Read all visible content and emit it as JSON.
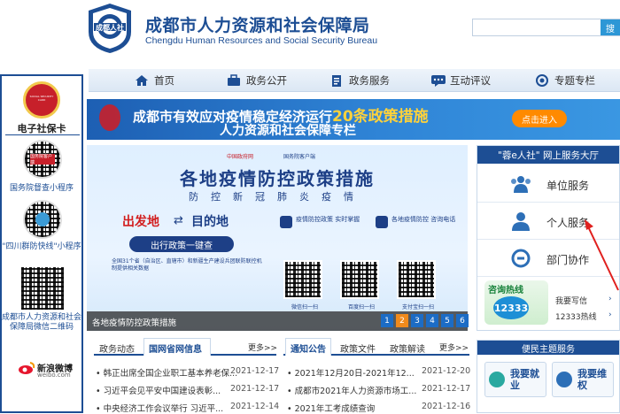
{
  "header": {
    "logo_text": "成都人社",
    "title_cn": "成都市人力资源和社会保障局",
    "title_en": "Chengdu Human Resources and Social Security Bureau",
    "search_button": "搜"
  },
  "nav": {
    "items": [
      {
        "label": "首页",
        "icon": "home-icon"
      },
      {
        "label": "政务公开",
        "icon": "briefcase-icon"
      },
      {
        "label": "政务服务",
        "icon": "clipboard-icon"
      },
      {
        "label": "互动评议",
        "icon": "chat-icon"
      },
      {
        "label": "专题专栏",
        "icon": "medal-icon"
      }
    ]
  },
  "left_sidebar": {
    "badge_text": "SOCIAL SECURITY CARD",
    "social_card_label": "电子社保卡",
    "qr1_label": "国务院客户端",
    "qr1_caption": "国务院督查小程序",
    "qr2_caption": "\"四川群防快线\"小程序",
    "qr3_caption": "成都市人力资源和社会保障局微信二维码",
    "weibo_label": "新浪微博",
    "weibo_sub": "weibo.com"
  },
  "banner": {
    "line1_prefix": "成都市有效应对疫情稳定经济运行",
    "line1_highlight": "20条政策措施",
    "line2": "人力资源和社会保障专栏",
    "button": "点击进入"
  },
  "slide": {
    "logo1": "中国政府网",
    "logo2": "国务院客户端",
    "title": "各地疫情防控政策措施",
    "subtitle": "防控新冠肺炎疫情",
    "from": "出发地",
    "to": "目的地",
    "query_btn": "出行政策一键查",
    "note": "全国31个省（自治区、直辖市）和新疆生产建设兵团联防联控机制提供相关数据",
    "feature1": "疫情防控政策 实时掌握",
    "feature2": "各地疫情防控 咨询电话",
    "qr_labels": [
      "微信扫一扫",
      "百度扫一扫",
      "支付宝扫一扫"
    ],
    "caption": "各地疫情防控政策措施",
    "pages": [
      "1",
      "2",
      "3",
      "4",
      "5",
      "6"
    ],
    "active_page": "2"
  },
  "service_hall": {
    "title": "\"蓉e人社\" 网上服务大厅",
    "items": [
      {
        "label": "单位服务",
        "icon": "group-icon"
      },
      {
        "label": "个人服务",
        "icon": "person-icon"
      },
      {
        "label": "部门协作",
        "icon": "link-icon"
      }
    ],
    "hotline_title": "咨询热线",
    "hotline_number": "12333",
    "links": [
      "我要写信",
      "12333热线"
    ]
  },
  "news1": {
    "tabs": [
      "政务动态",
      "国网省网信息"
    ],
    "more": "更多>>",
    "rows": [
      {
        "title": "韩正出席全国企业职工基本养老保...",
        "date": "2021-12-17"
      },
      {
        "title": "习近平会见平安中国建设表彰...",
        "date": "2021-12-17"
      },
      {
        "title": "中央经济工作会议举行 习近平...",
        "date": "2021-12-14"
      }
    ]
  },
  "news2": {
    "tabs": [
      "通知公告",
      "政策文件",
      "政策解读"
    ],
    "more": "更多>>",
    "rows": [
      {
        "title": "2021年12月20日-2021年12...",
        "date": "2021-12-20"
      },
      {
        "title": "成都市2021年人力资源市场工...",
        "date": "2021-12-17"
      },
      {
        "title": "2021年工考成绩查询",
        "date": "2021-12-16"
      }
    ]
  },
  "theme_service": {
    "title": "便民主题服务",
    "items": [
      {
        "label": "我要就业",
        "icon": "job-icon"
      },
      {
        "label": "我要维权",
        "icon": "rights-icon"
      }
    ]
  },
  "colors": {
    "primary": "#1d4e94",
    "accent": "#2d97d6",
    "highlight": "#ffd23a",
    "orange": "#ff8a00"
  }
}
